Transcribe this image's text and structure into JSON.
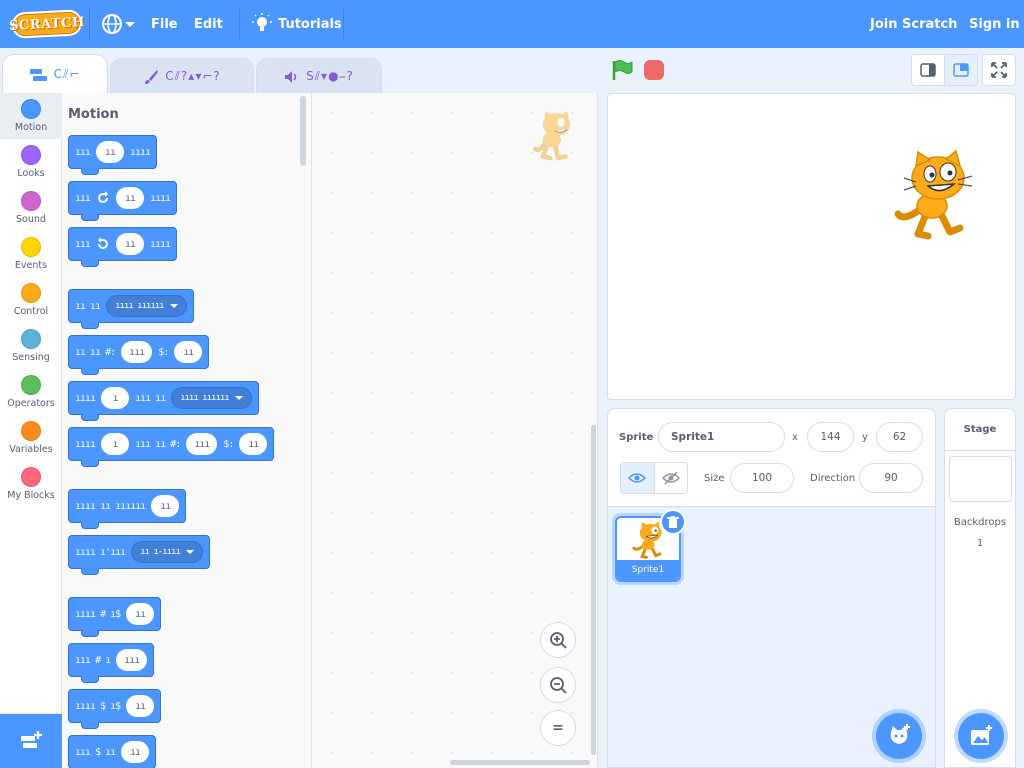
{
  "menubar": {
    "logo_text": "SCRATCH",
    "file_label": "File",
    "edit_label": "Edit",
    "tutorials_label": "Tutorials",
    "join_label": "Join Scratch",
    "signin_label": "Sign in"
  },
  "tabs": [
    {
      "label": "C⫽⌐",
      "icon": "code-icon"
    },
    {
      "label": "C⫽?▴▾⌐?",
      "icon": "brush-icon"
    },
    {
      "label": "S⫽▾●⎯?",
      "icon": "speaker-icon"
    }
  ],
  "categories": [
    {
      "label": "Motion",
      "color": "#4c97ff"
    },
    {
      "label": "Looks",
      "color": "#9966ff"
    },
    {
      "label": "Sound",
      "color": "#cf63cf"
    },
    {
      "label": "Events",
      "color": "#ffd500"
    },
    {
      "label": "Control",
      "color": "#ffab19"
    },
    {
      "label": "Sensing",
      "color": "#5cb1d6"
    },
    {
      "label": "Operators",
      "color": "#59c059"
    },
    {
      "label": "Variables",
      "color": "#ff8c1a"
    },
    {
      "label": "My Blocks",
      "color": "#ff6680"
    }
  ],
  "palette": {
    "section_title": "Motion",
    "blocks": [
      {
        "text": "ııı",
        "pill": "ıı",
        "after": "ıııı"
      },
      {
        "text": "ııı",
        "pill": "ıı",
        "after": "ıııı"
      },
      {
        "text": "ııı",
        "pill": "ıı",
        "after": "ıııı"
      },
      {
        "text": "ıı ıı",
        "dropdown": "ıııı ıııııı"
      },
      {
        "text": "ıı ıı #:",
        "pill": "ııı",
        "mid": "$:",
        "pill2": "ıı"
      },
      {
        "text": "ıııı",
        "pill": "ı",
        "mid": "ııı ıı",
        "dropdown": "ıııı ıııııı"
      },
      {
        "text": "ıııı",
        "pill": "ı",
        "mid": "ııı ıı #:",
        "pill2": "ııı",
        "mid2": "$:",
        "pill3": "ıı"
      },
      {
        "text": "ıııı ıı ıııııı",
        "pill": "ıı"
      },
      {
        "text": "ıııı ı'ııı",
        "dropdown": "ıı ı-ıııı"
      },
      {
        "text": "ıııı # ı$",
        "pill": "ıı"
      },
      {
        "text": "ııı # ı",
        "pill": "ııı"
      },
      {
        "text": "ıııı $ ı$",
        "pill": "ıı"
      },
      {
        "text": "ııı $ ıı",
        "pill": "ıı"
      }
    ]
  },
  "zoom": {
    "in": "zoom-in",
    "out": "zoom-out",
    "reset": "="
  },
  "sprite_info": {
    "sprite_label": "Sprite",
    "sprite_name": "Sprite1",
    "x_label": "x",
    "x_value": "144",
    "y_label": "y",
    "y_value": "62",
    "size_label": "Size",
    "size_value": "100",
    "direction_label": "Direction",
    "direction_value": "90"
  },
  "sprites": [
    {
      "name": "Sprite1"
    }
  ],
  "stage_pane": {
    "title": "Stage",
    "backdrops_label": "Backdrops",
    "backdrops_count": "1"
  },
  "colors": {
    "menubar": "#4c97ff",
    "motion": "#4c97ff",
    "stop": "#ec5959",
    "flag": "#4cbf56"
  }
}
